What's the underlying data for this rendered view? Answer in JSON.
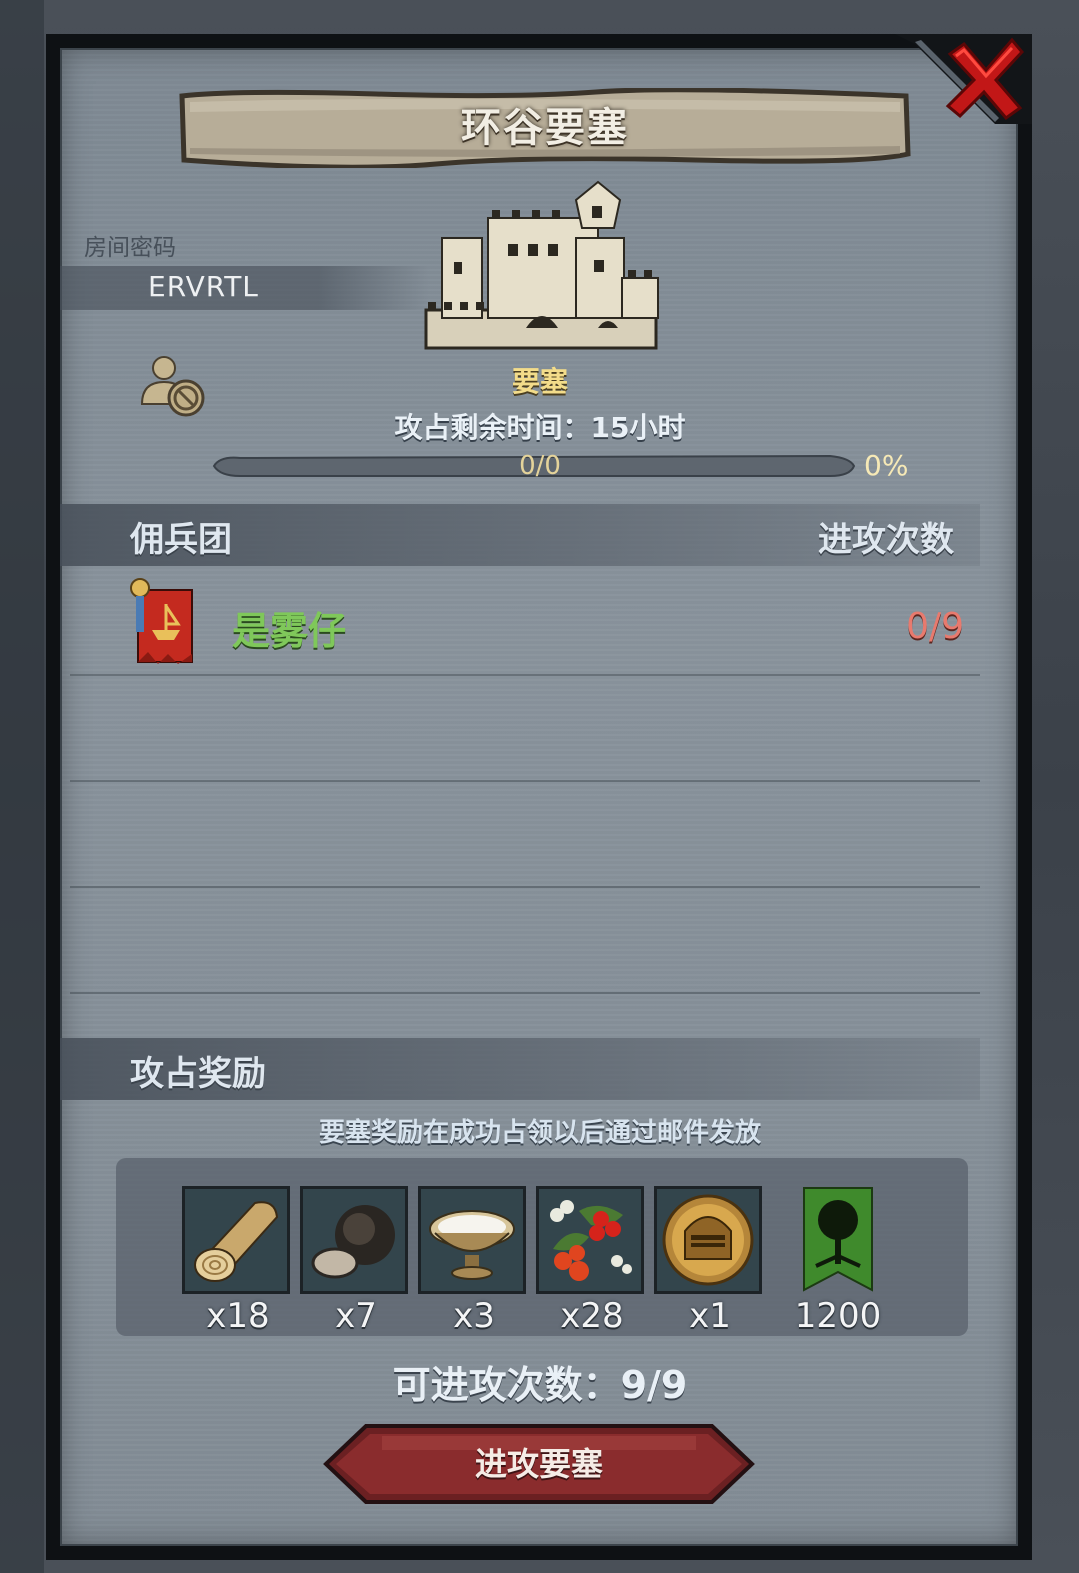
{
  "dialog": {
    "title": "环谷要塞",
    "room": {
      "label": "房间密码",
      "code": "ERVRTL"
    },
    "fortress": {
      "label": "要塞",
      "timer": "攻占剩余时间：15小时",
      "progress": {
        "text": "0/0",
        "percent_text": "0%",
        "fraction": 0
      }
    },
    "mercenaries": {
      "header": "佣兵团",
      "attacks_header": "进攻次数",
      "rows": [
        {
          "name": "是雾仔",
          "count": "0/9",
          "name_color": "#7fc85a",
          "count_color": "#e87a6e"
        }
      ]
    },
    "rewards": {
      "header": "攻占奖励",
      "note": "要塞奖励在成功占领以后通过邮件发放",
      "items": [
        {
          "icon": "wood-log-icon",
          "qty": "x18"
        },
        {
          "icon": "truffle-icon",
          "qty": "x7"
        },
        {
          "icon": "milk-bowl-icon",
          "qty": "x3"
        },
        {
          "icon": "berries-icon",
          "qty": "x28"
        },
        {
          "icon": "knight-helmet-coin-icon",
          "qty": "x1"
        },
        {
          "icon": "tree-banner-icon",
          "qty": "1200"
        }
      ]
    },
    "attempts": "可进攻次数：9/9",
    "attack_button": "进攻要塞"
  }
}
